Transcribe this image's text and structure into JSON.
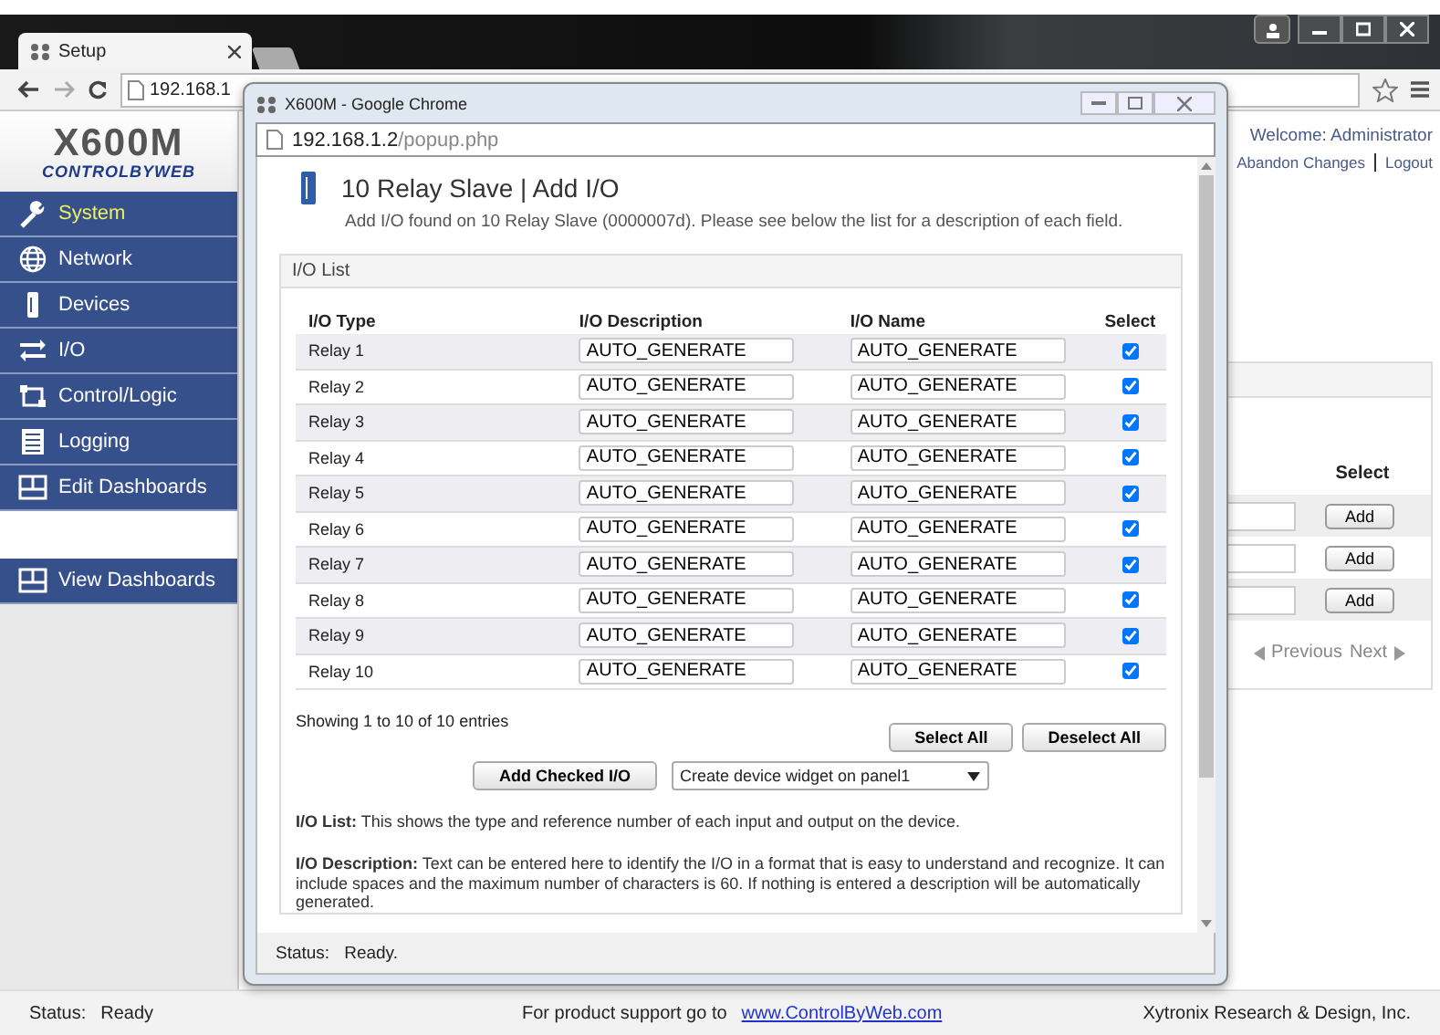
{
  "browser": {
    "tab_title": "Setup",
    "url": "192.168.1"
  },
  "sidebar": {
    "logo": "X600M",
    "brand": "CONTROLBYWEB",
    "items": [
      {
        "label": "System",
        "selected": true
      },
      {
        "label": "Network",
        "selected": false
      },
      {
        "label": "Devices",
        "selected": false
      },
      {
        "label": "I/O",
        "selected": false
      },
      {
        "label": "Control/Logic",
        "selected": false
      },
      {
        "label": "Logging",
        "selected": false
      },
      {
        "label": "Edit Dashboards",
        "selected": false
      }
    ],
    "bottom_item": {
      "label": "View Dashboards"
    }
  },
  "header": {
    "welcome": "Welcome: Administrator",
    "links": [
      "Abandon Changes",
      "Logout"
    ]
  },
  "panel": {
    "column": "Select",
    "buttons": [
      "Add",
      "Add",
      "Add"
    ],
    "previous": "Previous",
    "next": "Next"
  },
  "status_bar": {
    "label": "Status:",
    "value": "Ready",
    "support_text": "For product support go to",
    "support_link": "www.ControlByWeb.com",
    "company": "Xytronix Research & Design, Inc."
  },
  "popup": {
    "window_title": "X600M - Google Chrome",
    "url_host": "192.168.1.2",
    "url_path": "/popup.php",
    "title": "10 Relay Slave | Add I/O",
    "subtitle": "Add I/O found on 10 Relay Slave (0000007d). Please see below the list for a description of each field.",
    "list_title": "I/O List",
    "columns": [
      "I/O Type",
      "I/O Description",
      "I/O Name",
      "Select"
    ],
    "rows": [
      {
        "type": "Relay 1",
        "description": "AUTO_GENERATE",
        "name": "AUTO_GENERATE",
        "checked": true
      },
      {
        "type": "Relay 2",
        "description": "AUTO_GENERATE",
        "name": "AUTO_GENERATE",
        "checked": true
      },
      {
        "type": "Relay 3",
        "description": "AUTO_GENERATE",
        "name": "AUTO_GENERATE",
        "checked": true
      },
      {
        "type": "Relay 4",
        "description": "AUTO_GENERATE",
        "name": "AUTO_GENERATE",
        "checked": true
      },
      {
        "type": "Relay 5",
        "description": "AUTO_GENERATE",
        "name": "AUTO_GENERATE",
        "checked": true
      },
      {
        "type": "Relay 6",
        "description": "AUTO_GENERATE",
        "name": "AUTO_GENERATE",
        "checked": true
      },
      {
        "type": "Relay 7",
        "description": "AUTO_GENERATE",
        "name": "AUTO_GENERATE",
        "checked": true
      },
      {
        "type": "Relay 8",
        "description": "AUTO_GENERATE",
        "name": "AUTO_GENERATE",
        "checked": true
      },
      {
        "type": "Relay 9",
        "description": "AUTO_GENERATE",
        "name": "AUTO_GENERATE",
        "checked": true
      },
      {
        "type": "Relay 10",
        "description": "AUTO_GENERATE",
        "name": "AUTO_GENERATE",
        "checked": true
      }
    ],
    "entries": "Showing 1 to 10 of 10 entries",
    "select_all": "Select All",
    "deselect_all": "Deselect All",
    "add_button": "Add Checked I/O",
    "widget_select": "Create device widget on panel1",
    "help": [
      "**I/O List:** This shows the type and reference number of each input and output on the device.",
      "**I/O Description:** Text can be entered here to identify the I/O in a format that is easy to understand and recognize. It can include spaces and the maximum number of characters is 60. If nothing is entered a description will be automatically generated."
    ],
    "status_label": "Status:",
    "status_value": "Ready."
  }
}
